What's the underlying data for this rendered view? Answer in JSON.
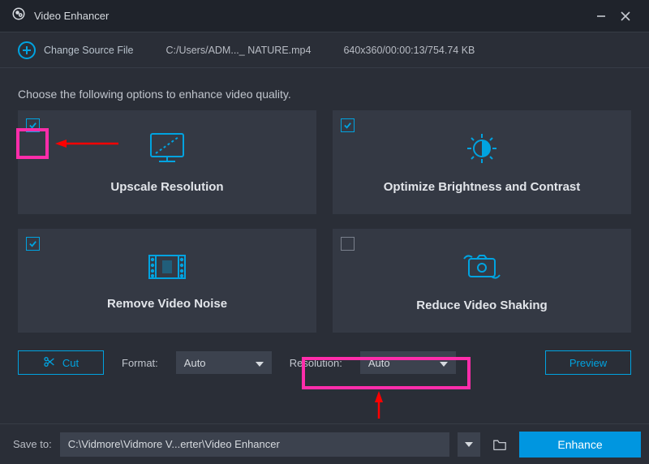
{
  "titlebar": {
    "title": "Video Enhancer"
  },
  "source": {
    "change_label": "Change Source File",
    "path": "C:/Users/ADM..._ NATURE.mp4",
    "meta": "640x360/00:00:13/754.74 KB"
  },
  "subtitle": "Choose the following options to enhance video quality.",
  "cards": {
    "upscale": {
      "label": "Upscale Resolution",
      "checked": true
    },
    "brightness": {
      "label": "Optimize Brightness and Contrast",
      "checked": true
    },
    "noise": {
      "label": "Remove Video Noise",
      "checked": true
    },
    "shaking": {
      "label": "Reduce Video Shaking",
      "checked": false
    }
  },
  "bottom": {
    "cut_label": "Cut",
    "format_label": "Format:",
    "format_value": "Auto",
    "resolution_label": "Resolution:",
    "resolution_value": "Auto",
    "preview_label": "Preview"
  },
  "footer": {
    "saveto_label": "Save to:",
    "path": "C:\\Vidmore\\Vidmore V...erter\\Video Enhancer",
    "enhance_label": "Enhance"
  }
}
